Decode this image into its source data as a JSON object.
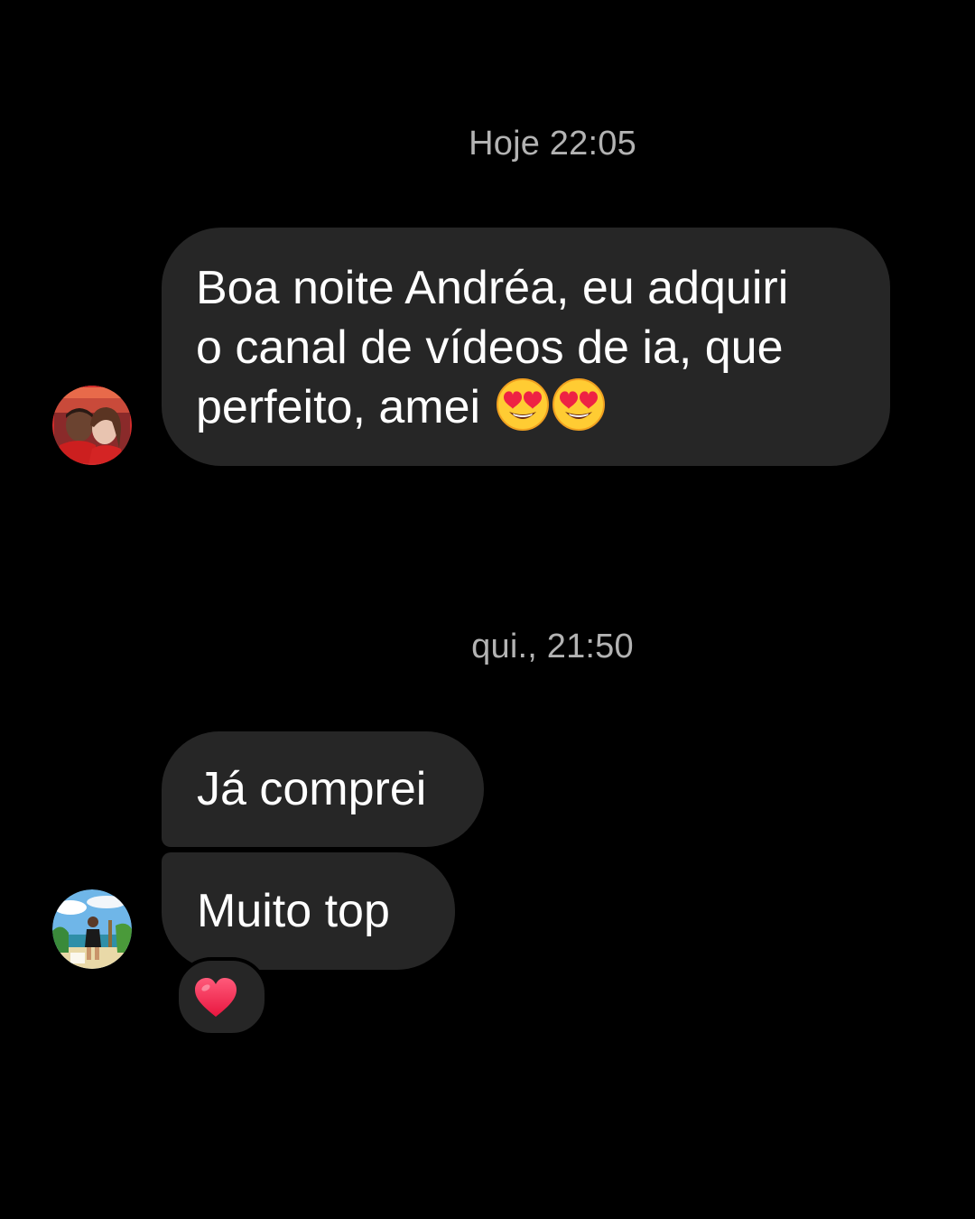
{
  "thread": {
    "groups": [
      {
        "timestamp": "Hoje 22:05",
        "sender_avatar": "couple-photo-avatar",
        "messages": [
          {
            "lines": [
              "Boa noite Andréa, eu adquiri",
              "o canal de vídeos de ia, que",
              "perfeito, amei"
            ],
            "trailing_emoji": [
              "heart-eyes-emoji",
              "heart-eyes-emoji"
            ]
          }
        ]
      },
      {
        "timestamp": "qui., 21:50",
        "sender_avatar": "beach-photo-avatar",
        "messages": [
          {
            "text": "Já comprei"
          },
          {
            "text": "Muito top",
            "reaction": "red-heart-icon"
          }
        ]
      }
    ]
  },
  "colors": {
    "background": "#000000",
    "bubble": "#262626",
    "timestamp_text": "#b3b3b3",
    "message_text": "#ffffff",
    "reaction_heart": "#f0325c"
  }
}
